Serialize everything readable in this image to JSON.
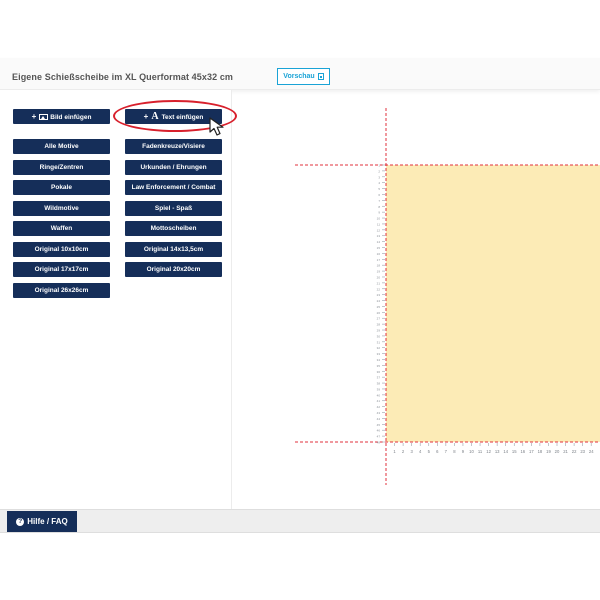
{
  "header": {
    "title": "Eigene Schießscheibe im XL Querformat 45x32 cm",
    "preview_label": "Vorschau"
  },
  "toolbar": {
    "insert_image_label": "Bild einfügen",
    "insert_text_label": "Text einfügen"
  },
  "categories": [
    "Alle Motive",
    "Fadenkreuze/Visiere",
    "Ringe/Zentren",
    "Urkunden / Ehrungen",
    "Pokale",
    "Law Enforcement / Combat",
    "Wildmotive",
    "Spiel - Spaß",
    "Waffen",
    "Mottoscheiben",
    "Original 10x10cm",
    "Original 14x13,5cm",
    "Original 17x17cm",
    "Original 20x20cm",
    "Original 26x26cm"
  ],
  "canvas": {
    "ruler_labels": [
      "1",
      "2",
      "3",
      "4",
      "5",
      "6",
      "7",
      "8",
      "9",
      "10",
      "11",
      "12",
      "13",
      "14",
      "15",
      "16",
      "17",
      "18",
      "19",
      "20",
      "21",
      "22",
      "23",
      "24"
    ],
    "area_color": "#fcebb6",
    "guide_color": "#e0303c"
  },
  "footer": {
    "help_label": "Hilfe / FAQ"
  }
}
